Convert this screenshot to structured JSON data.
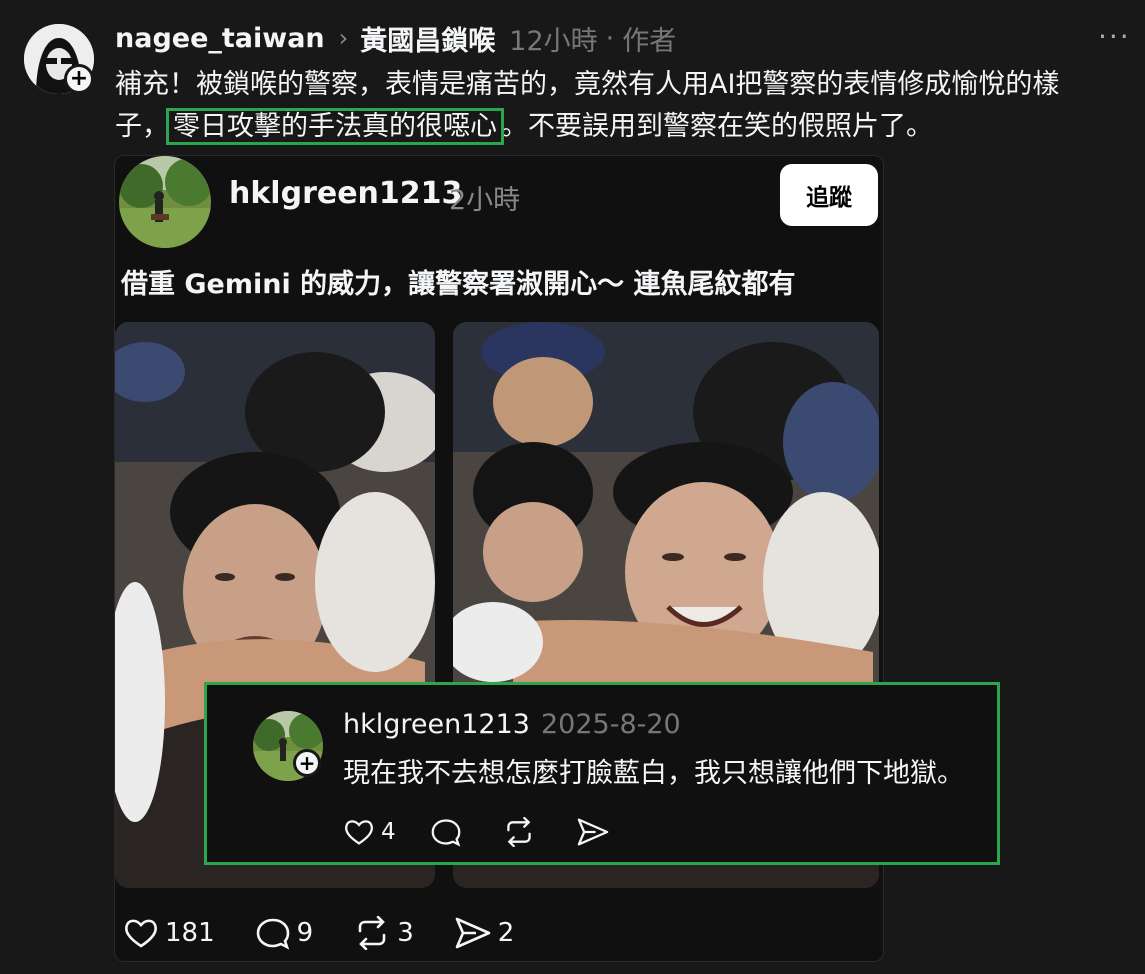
{
  "post": {
    "username": "nagee_taiwan",
    "topic": "黃國昌鎖喉",
    "time": "12小時",
    "separator": "·",
    "author_label": "作者",
    "text_line1": "補充！被鎖喉的警察，表情是痛苦的，竟然有人用AI把警察的表情修成愉悅的樣",
    "text_line2_before": "子，",
    "text_highlight": "零日攻擊的手法真的很噁心",
    "text_line2_after": "。不要誤用到警察在笑的假照片了。"
  },
  "quoted": {
    "username": "hklgreen1213",
    "time": "2小時",
    "follow_label": "追蹤",
    "text": "借重 Gemini 的威力，讓警察署淑開心～ 連魚尾紋都有",
    "likes": "181",
    "comments": "9",
    "reposts": "3",
    "shares": "2"
  },
  "reply": {
    "username": "hklgreen1213",
    "date": "2025-8-20",
    "text": "現在我不去想怎麼打臉藍白，我只想讓他們下地獄。",
    "likes": "4"
  },
  "icons": {
    "more": "more-horizontal-icon",
    "like": "heart-icon",
    "comment": "comment-icon",
    "repost": "repost-icon",
    "share": "send-icon"
  },
  "colors": {
    "background": "#181818",
    "highlight_box": "#2da44e",
    "follow_button": "#ffffff"
  }
}
